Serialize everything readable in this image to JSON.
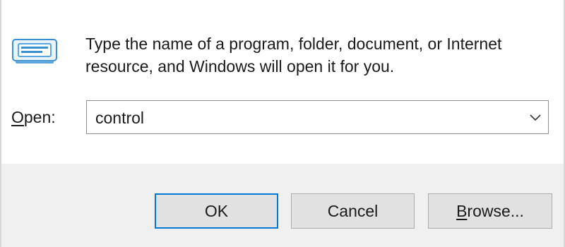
{
  "dialog": {
    "description_line1": "Type the name of a program, folder, document, or Internet",
    "description_line2": "resource, and Windows will open it for you.",
    "icon": "run-dialog-icon"
  },
  "open_field": {
    "label_accel": "O",
    "label_rest": "pen:",
    "value": "control",
    "dropdown_icon": "chevron-down-icon"
  },
  "buttons": {
    "ok_label": "OK",
    "cancel_label": "Cancel",
    "browse_accel": "B",
    "browse_rest": "rowse..."
  },
  "colors": {
    "accent_border": "#0078d7",
    "button_face": "#e1e1e1",
    "footer_background": "#f0f0f0"
  }
}
